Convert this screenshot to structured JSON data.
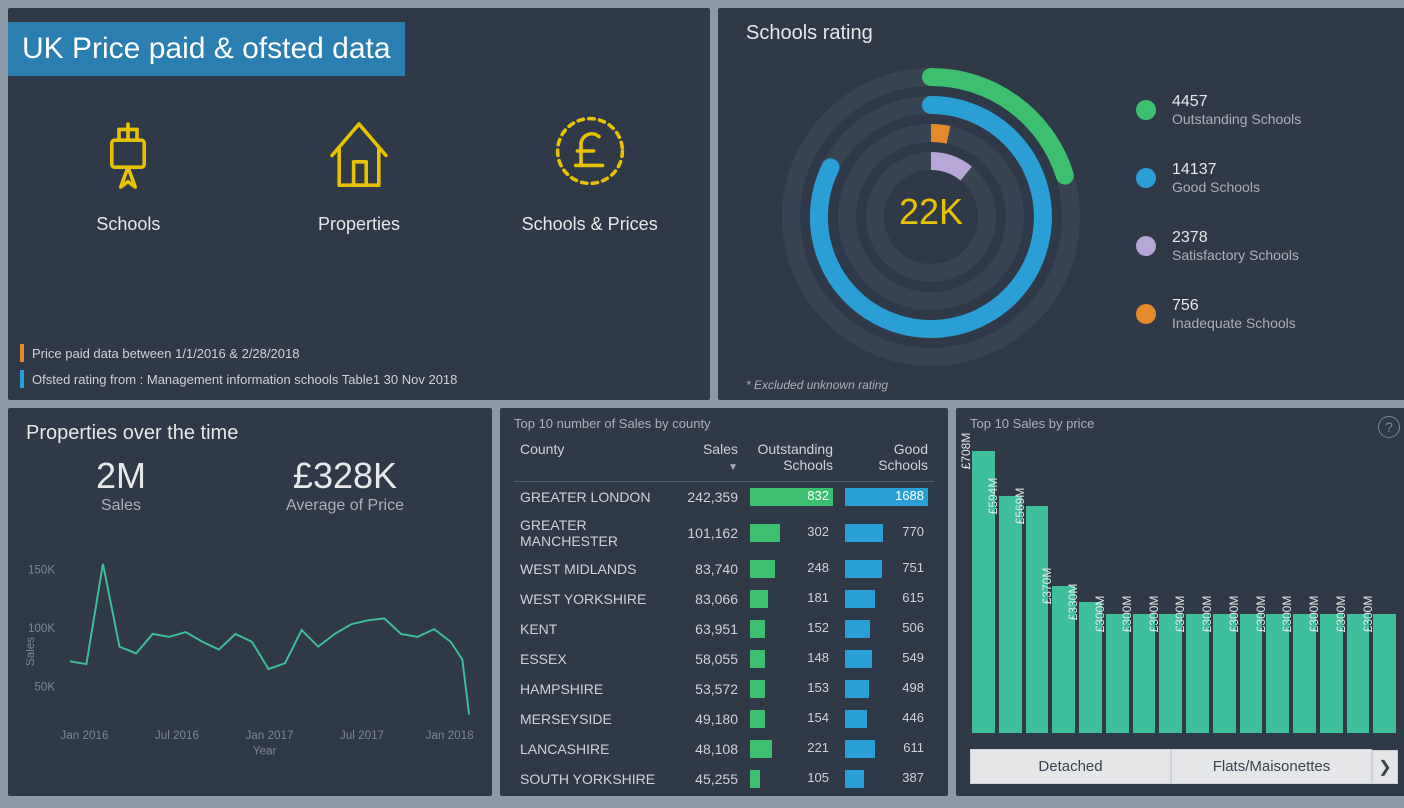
{
  "header": {
    "title": "UK Price paid & ofsted data",
    "nav": [
      {
        "label": "Schools"
      },
      {
        "label": "Properties"
      },
      {
        "label": "Schools & Prices"
      }
    ],
    "sources": [
      {
        "color": "#e48a2a",
        "text": "Price paid data between 1/1/2016 & 2/28/2018"
      },
      {
        "color": "#2a9fd6",
        "text": "Ofsted rating from : Management information schools Table1 30 Nov 2018"
      }
    ]
  },
  "rating": {
    "title": "Schools rating",
    "center": "22K",
    "footnote": "* Excluded unknown rating",
    "items": [
      {
        "value": "4457",
        "label": "Outstanding Schools",
        "color": "#3cbf6f"
      },
      {
        "value": "14137",
        "label": "Good Schools",
        "color": "#2a9fd6"
      },
      {
        "value": "2378",
        "label": "Satisfactory Schools",
        "color": "#b7a7d6"
      },
      {
        "value": "756",
        "label": "Inadequate Schools",
        "color": "#e48a2a"
      }
    ]
  },
  "line": {
    "title": "Properties over the time",
    "kpi1_value": "2M",
    "kpi1_label": "Sales",
    "kpi2_value": "£328K",
    "kpi2_label": "Average of Price",
    "y_label": "Sales",
    "x_label": "Year",
    "y_ticks": [
      "50K",
      "100K",
      "150K"
    ],
    "x_ticks": [
      "Jan 2016",
      "Jul 2016",
      "Jan 2017",
      "Jul 2017",
      "Jan 2018"
    ]
  },
  "table": {
    "title": "Top 10 number of Sales by county",
    "columns": [
      "County",
      "Sales",
      "Outstanding Schools",
      "Good Schools"
    ],
    "rows": [
      {
        "county": "GREATER LONDON",
        "sales": "242,359",
        "out": 832,
        "good": 1688,
        "hl": true
      },
      {
        "county": "GREATER MANCHESTER",
        "sales": "101,162",
        "out": 302,
        "good": 770
      },
      {
        "county": "WEST MIDLANDS",
        "sales": "83,740",
        "out": 248,
        "good": 751
      },
      {
        "county": "WEST YORKSHIRE",
        "sales": "83,066",
        "out": 181,
        "good": 615
      },
      {
        "county": "KENT",
        "sales": "63,951",
        "out": 152,
        "good": 506
      },
      {
        "county": "ESSEX",
        "sales": "58,055",
        "out": 148,
        "good": 549
      },
      {
        "county": "HAMPSHIRE",
        "sales": "53,572",
        "out": 153,
        "good": 498
      },
      {
        "county": "MERSEYSIDE",
        "sales": "49,180",
        "out": 154,
        "good": 446
      },
      {
        "county": "LANCASHIRE",
        "sales": "48,108",
        "out": 221,
        "good": 611
      },
      {
        "county": "SOUTH YORKSHIRE",
        "sales": "45,255",
        "out": 105,
        "good": 387
      }
    ],
    "out_max": 832,
    "good_max": 1688,
    "out_color": "#3cbf6f",
    "good_color": "#2a9fd6"
  },
  "bars": {
    "title": "Top 10 Sales by price",
    "labels": [
      "£708M",
      "£594M",
      "£569M",
      "£370M",
      "£330M",
      "£300M",
      "£300M",
      "£300M",
      "£300M",
      "£300M",
      "£300M",
      "£300M",
      "£300M",
      "£300M",
      "£300M",
      "£300M"
    ],
    "values": [
      708,
      594,
      569,
      370,
      330,
      300,
      300,
      300,
      300,
      300,
      300,
      300,
      300,
      300,
      300,
      300
    ],
    "max": 708,
    "slicer": [
      "Detached",
      "Flats/Maisonettes"
    ]
  },
  "chart_data": [
    {
      "type": "donut",
      "title": "Schools rating",
      "center_value": "22K",
      "series": [
        {
          "name": "Outstanding Schools",
          "value": 4457,
          "color": "#3cbf6f"
        },
        {
          "name": "Good Schools",
          "value": 14137,
          "color": "#2a9fd6"
        },
        {
          "name": "Satisfactory Schools",
          "value": 2378,
          "color": "#b7a7d6"
        },
        {
          "name": "Inadequate Schools",
          "value": 756,
          "color": "#e48a2a"
        }
      ],
      "note": "* Excluded unknown rating"
    },
    {
      "type": "line",
      "title": "Properties over the time",
      "xlabel": "Year",
      "ylabel": "Sales",
      "ylim": [
        0,
        150000
      ],
      "x": [
        "Jan 2016",
        "Feb 2016",
        "Mar 2016",
        "Apr 2016",
        "May 2016",
        "Jun 2016",
        "Jul 2016",
        "Aug 2016",
        "Sep 2016",
        "Oct 2016",
        "Nov 2016",
        "Dec 2016",
        "Jan 2017",
        "Feb 2017",
        "Mar 2017",
        "Apr 2017",
        "May 2017",
        "Jun 2017",
        "Jul 2017",
        "Aug 2017",
        "Sep 2017",
        "Oct 2017",
        "Nov 2017",
        "Dec 2017",
        "Jan 2018",
        "Feb 2018"
      ],
      "values": [
        70000,
        68000,
        145000,
        80000,
        75000,
        90000,
        88000,
        92000,
        85000,
        80000,
        90000,
        85000,
        65000,
        70000,
        95000,
        80000,
        90000,
        98000,
        100000,
        102000,
        90000,
        88000,
        95000,
        85000,
        70000,
        30000
      ]
    },
    {
      "type": "table",
      "title": "Top 10 number of Sales by county",
      "columns": [
        "County",
        "Sales",
        "Outstanding Schools",
        "Good Schools"
      ],
      "rows": [
        [
          "GREATER LONDON",
          242359,
          832,
          1688
        ],
        [
          "GREATER MANCHESTER",
          101162,
          302,
          770
        ],
        [
          "WEST MIDLANDS",
          83740,
          248,
          751
        ],
        [
          "WEST YORKSHIRE",
          83066,
          181,
          615
        ],
        [
          "KENT",
          63951,
          152,
          506
        ],
        [
          "ESSEX",
          58055,
          148,
          549
        ],
        [
          "HAMPSHIRE",
          53572,
          153,
          498
        ],
        [
          "MERSEYSIDE",
          49180,
          154,
          446
        ],
        [
          "LANCASHIRE",
          48108,
          221,
          611
        ],
        [
          "SOUTH YORKSHIRE",
          45255,
          105,
          387
        ]
      ]
    },
    {
      "type": "bar",
      "title": "Top 10 Sales by price",
      "labels": [
        "£708M",
        "£594M",
        "£569M",
        "£370M",
        "£330M",
        "£300M",
        "£300M",
        "£300M",
        "£300M",
        "£300M",
        "£300M",
        "£300M",
        "£300M",
        "£300M",
        "£300M",
        "£300M"
      ],
      "values": [
        708,
        594,
        569,
        370,
        330,
        300,
        300,
        300,
        300,
        300,
        300,
        300,
        300,
        300,
        300,
        300
      ],
      "ylim": [
        0,
        708
      ]
    }
  ]
}
